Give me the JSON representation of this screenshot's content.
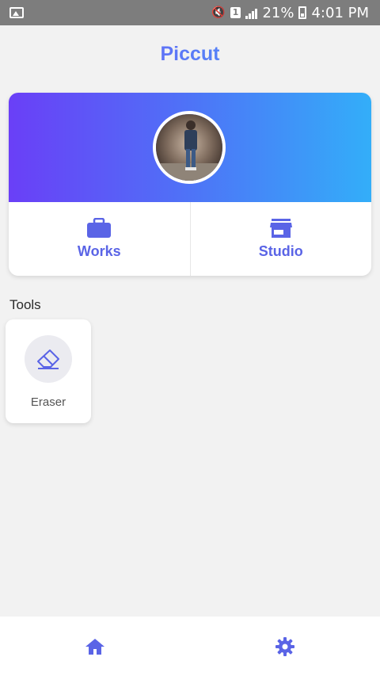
{
  "status_bar": {
    "sim_label": "1",
    "battery_percent": "21%",
    "time": "4:01 PM",
    "icons": [
      "gallery-icon",
      "mute-icon",
      "sim-icon",
      "signal-icon",
      "battery-icon"
    ]
  },
  "app": {
    "title": "Piccut"
  },
  "profile": {
    "banner_gradient": [
      "#6a3ff7",
      "#33aef9"
    ],
    "actions": [
      {
        "label": "Works",
        "icon": "briefcase-icon"
      },
      {
        "label": "Studio",
        "icon": "storefront-icon"
      }
    ]
  },
  "tools": {
    "section_title": "Tools",
    "items": [
      {
        "label": "Eraser",
        "icon": "eraser-icon"
      }
    ]
  },
  "bottom_nav": {
    "items": [
      {
        "icon": "home-icon"
      },
      {
        "icon": "settings-icon"
      }
    ]
  },
  "colors": {
    "accent": "#5a64e6",
    "status_bar": "#7d7d7d",
    "background": "#f2f2f2"
  }
}
